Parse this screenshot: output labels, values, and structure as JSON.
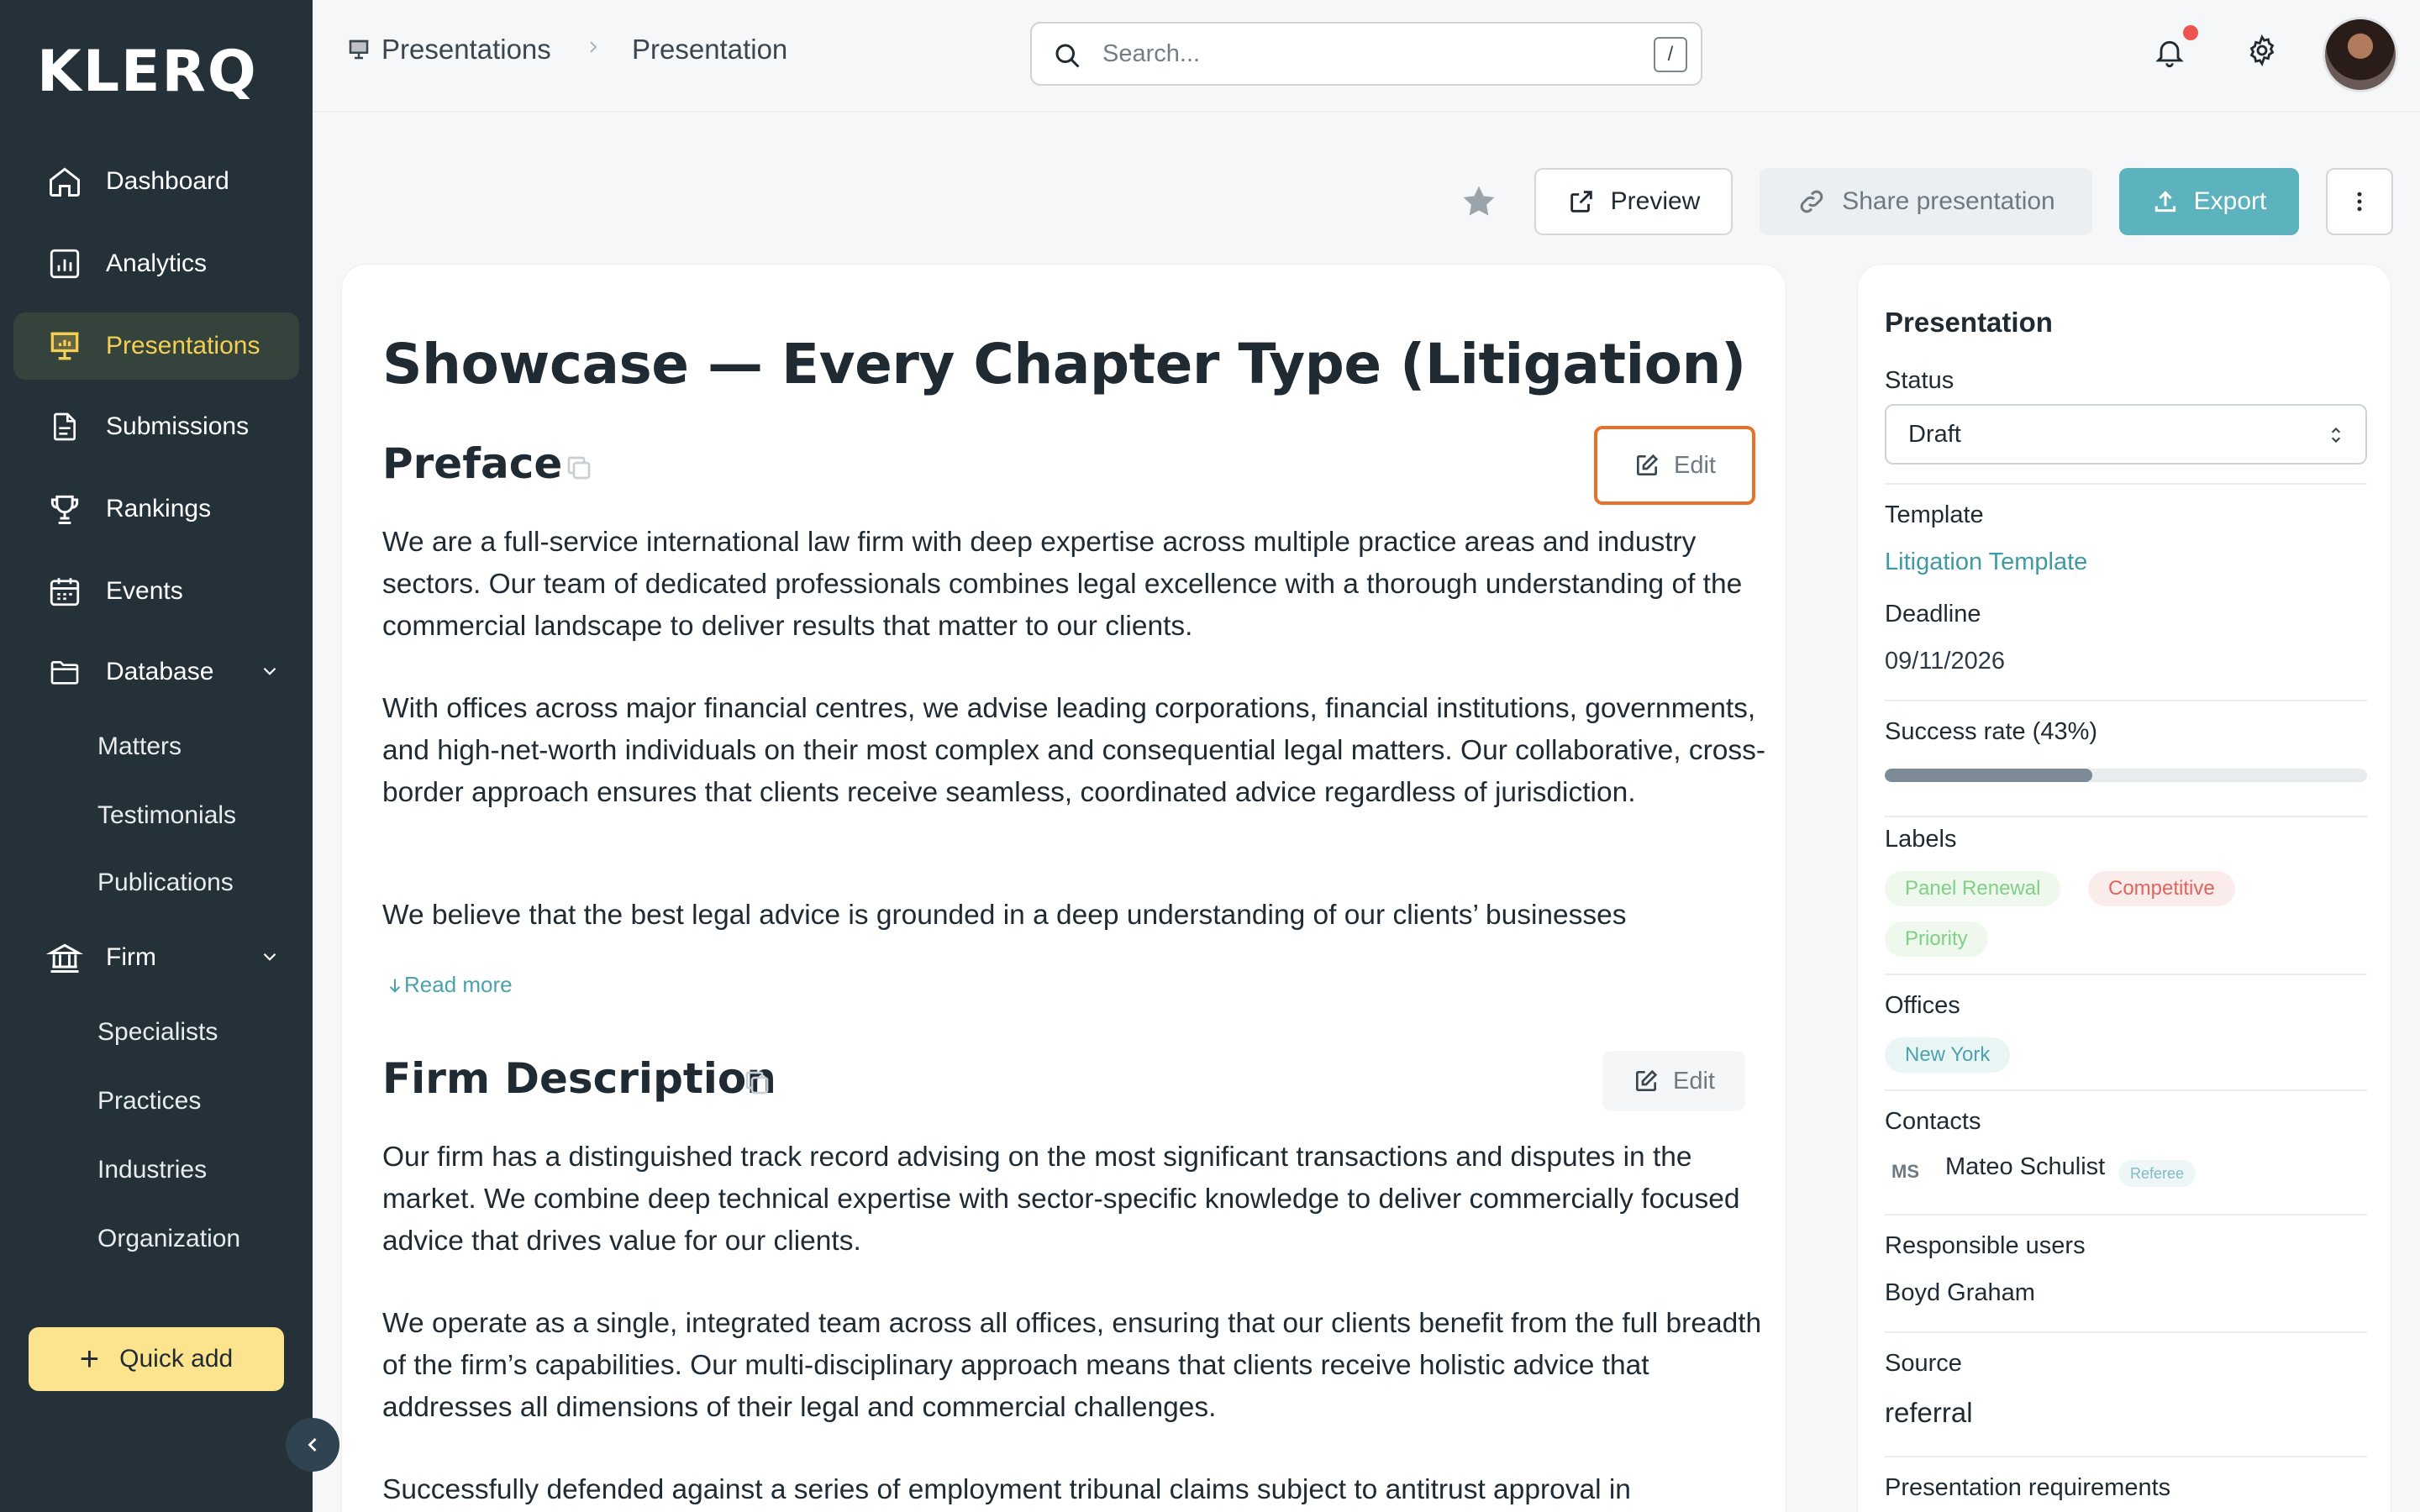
{
  "app": {
    "logo": "KLERQ"
  },
  "sidebar": {
    "items": [
      {
        "label": "Dashboard",
        "icon": "home-icon"
      },
      {
        "label": "Analytics",
        "icon": "analytics-icon"
      },
      {
        "label": "Presentations",
        "icon": "presentation-icon",
        "active": true
      },
      {
        "label": "Submissions",
        "icon": "document-icon"
      },
      {
        "label": "Rankings",
        "icon": "trophy-icon"
      },
      {
        "label": "Events",
        "icon": "calendar-icon"
      },
      {
        "label": "Database",
        "icon": "folder-icon",
        "expandable": true
      },
      {
        "label": "Firm",
        "icon": "bank-icon",
        "expandable": true
      }
    ],
    "database_children": [
      "Matters",
      "Testimonials",
      "Publications"
    ],
    "firm_children": [
      "Specialists",
      "Practices",
      "Industries",
      "Organization"
    ],
    "quick_add": "Quick add"
  },
  "header": {
    "breadcrumb": [
      "Presentations",
      "Presentation"
    ],
    "search_placeholder": "Search...",
    "search_shortcut": "/"
  },
  "actions": {
    "preview": "Preview",
    "share": "Share presentation",
    "export": "Export"
  },
  "document": {
    "title": "Showcase — Every Chapter Type (Litigation)",
    "edit_label": "Edit",
    "read_more": "Read more",
    "sections": [
      {
        "heading": "Preface",
        "paragraphs": [
          "We are a full-service international law firm with deep expertise across multiple practice areas and industry sectors. Our team of dedicated professionals combines legal excellence with a thorough understanding of the commercial landscape to deliver results that matter to our clients.",
          "With offices across major financial centres, we advise leading corporations, financial institutions, governments, and high-net-worth individuals on their most complex and consequential legal matters. Our collaborative, cross-border approach ensures that clients receive seamless, coordinated advice regardless of jurisdiction.",
          "We believe that the best legal advice is grounded in a deep understanding of our clients’ businesses"
        ]
      },
      {
        "heading": "Firm Description",
        "paragraphs": [
          "Our firm has a distinguished track record advising on the most significant transactions and disputes in the market. We combine deep technical expertise with sector-specific knowledge to deliver commercially focused advice that drives value for our clients.",
          "We operate as a single, integrated team across all offices, ensuring that our clients benefit from the full breadth of the firm’s capabilities. Our multi-disciplinary approach means that clients receive holistic advice that addresses all dimensions of their legal and commercial challenges.",
          "Successfully defended against a series of employment tribunal claims subject to antitrust approval in"
        ]
      }
    ]
  },
  "panel": {
    "title": "Presentation",
    "status_label": "Status",
    "status_value": "Draft",
    "template_label": "Template",
    "template_value": "Litigation Template",
    "deadline_label": "Deadline",
    "deadline_value": "09/11/2026",
    "success_label": "Success rate (43%)",
    "success_rate": 0.43,
    "labels_label": "Labels",
    "labels": [
      {
        "text": "Panel Renewal",
        "color": "green"
      },
      {
        "text": "Competitive",
        "color": "red"
      },
      {
        "text": "Priority",
        "color": "green"
      }
    ],
    "offices_label": "Offices",
    "offices": [
      "New York"
    ],
    "contacts_label": "Contacts",
    "contact": {
      "initials": "MS",
      "name": "Mateo Schulist",
      "role": "Referee"
    },
    "responsible_label": "Responsible users",
    "responsible_value": "Boyd Graham",
    "source_label": "Source",
    "source_value": "referral",
    "requirements_label": "Presentation requirements"
  },
  "colors": {
    "sidebar_bg": "#243139",
    "active_accent": "#f5cf52",
    "export_bg": "#5cb3bd",
    "focus_outline": "#e8702a",
    "link": "#3f9aa5"
  }
}
